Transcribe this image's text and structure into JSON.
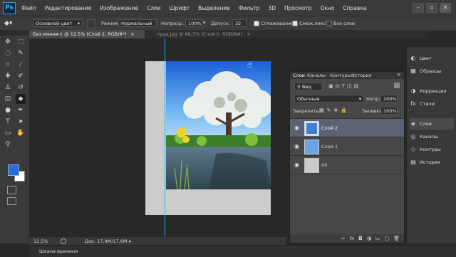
{
  "app": {
    "logo": "Ps"
  },
  "menu": [
    "Файл",
    "Редактирование",
    "Изображение",
    "Слои",
    "Шрифт",
    "Выделение",
    "Фильтр",
    "3D",
    "Просмотр",
    "Окно",
    "Справка"
  ],
  "window_controls": {
    "minimize": "–",
    "restore": "▫",
    "close": "✕"
  },
  "options": {
    "tool_preset": "Основной цвет",
    "mode_label": "Режим:",
    "mode_value": "Нормальный",
    "opacity_label": "Непрозр.:",
    "opacity_value": "100%",
    "tolerance_label": "Допуск:",
    "tolerance_value": "32",
    "anti_alias_label": "Сглаживание",
    "contiguous_label": "Смеж.пикс",
    "all_layers_label": "Все слои"
  },
  "tabs": [
    {
      "label": "Без имени-1 @ 12,5% (Слой 2, RGB/8*)",
      "close": "×"
    },
    {
      "label": "пруд.jpg @ 66,7% (Слой 0, RGB/8#)",
      "close": "×"
    }
  ],
  "tools": [
    {
      "icon": "move-icon",
      "glyph": "✥"
    },
    {
      "icon": "marquee-icon",
      "glyph": "⬚"
    },
    {
      "icon": "lasso-icon",
      "glyph": "◌"
    },
    {
      "icon": "quick-select-icon",
      "glyph": "✎"
    },
    {
      "icon": "crop-icon",
      "glyph": "⌗"
    },
    {
      "icon": "eyedropper-icon",
      "glyph": "⁄"
    },
    {
      "icon": "healing-icon",
      "glyph": "✚"
    },
    {
      "icon": "brush-icon",
      "glyph": "✐"
    },
    {
      "icon": "clone-stamp-icon",
      "glyph": "♙"
    },
    {
      "icon": "history-brush-icon",
      "glyph": "↺"
    },
    {
      "icon": "eraser-icon",
      "glyph": "◫"
    },
    {
      "icon": "paint-bucket-icon",
      "glyph": "◆"
    },
    {
      "icon": "dodge-icon",
      "glyph": "●"
    },
    {
      "icon": "pen-icon",
      "glyph": "✒"
    },
    {
      "icon": "type-icon",
      "glyph": "T"
    },
    {
      "icon": "path-select-icon",
      "glyph": "➤"
    },
    {
      "icon": "shape-icon",
      "glyph": "▭"
    },
    {
      "icon": "hand-icon",
      "glyph": "✋"
    },
    {
      "icon": "zoom-icon",
      "glyph": "⚲"
    }
  ],
  "colors": {
    "foreground": "#1f6fe0",
    "background": "#ffffff",
    "accent": "#2fa0e6"
  },
  "right_panels": [
    {
      "icon": "color-icon",
      "label": "Цвет"
    },
    {
      "icon": "swatches-icon",
      "label": "Образцы"
    },
    {
      "icon": "adjustments-icon",
      "label": "Коррекция"
    },
    {
      "icon": "styles-icon",
      "label": "Стили"
    },
    {
      "icon": "layers-icon",
      "label": "Слои"
    },
    {
      "icon": "channels-icon",
      "label": "Каналы"
    },
    {
      "icon": "paths-icon",
      "label": "Контуры"
    },
    {
      "icon": "history-icon",
      "label": "История"
    }
  ],
  "layers_panel": {
    "tabs": [
      "Слои",
      "Каналы",
      "Контуры",
      "История"
    ],
    "filter_value": "Вид",
    "blend_mode": "Обычные",
    "opacity_label": "Непр:",
    "opacity_value": "100%",
    "lock_label": "Закрепить:",
    "fill_label": "Заливка:",
    "fill_value": "100%",
    "layers": [
      {
        "name": "Слой 2",
        "selected": true
      },
      {
        "name": "Слой 1",
        "selected": false
      },
      {
        "name": "00",
        "selected": false
      }
    ],
    "footer_icons": [
      "link-icon",
      "fx-icon",
      "mask-icon",
      "adjustment-layer-icon",
      "group-icon",
      "new-layer-icon",
      "trash-icon"
    ]
  },
  "status": {
    "zoom": "12,5%",
    "doc": "Док: 17,9M/17,6M"
  },
  "timeline": {
    "label": "Шкала времени"
  }
}
